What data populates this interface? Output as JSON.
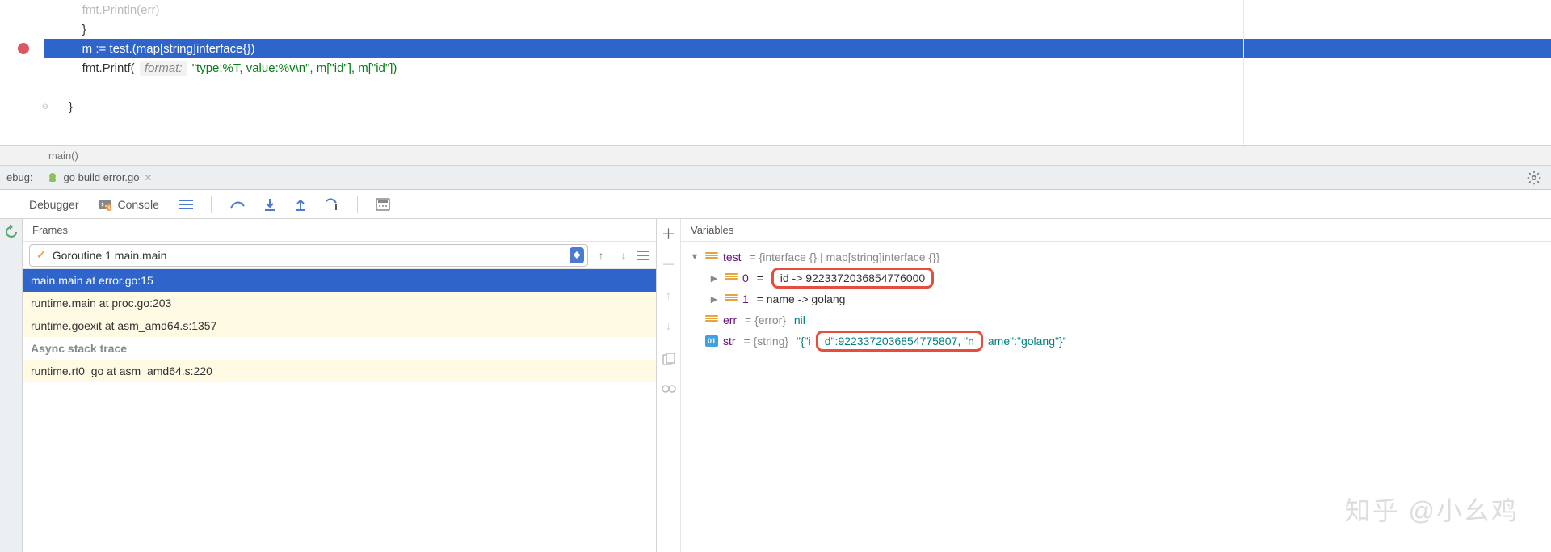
{
  "code": {
    "line1_partial": "    fmt.Println(err)",
    "line2": "    }",
    "line3": "    m := test.(map[string]interface{})",
    "line4_pre": "    fmt.Printf( ",
    "line4_hint": "format:",
    "line4_post": " \"type:%T, value:%v\\n\", m[\"id\"], m[\"id\"])",
    "line6": "}"
  },
  "breadcrumb": "main()",
  "debug": {
    "label": "ebug:",
    "tab": "go build error.go"
  },
  "panels": {
    "debugger": "Debugger",
    "console": "Console",
    "frames": "Frames",
    "variables": "Variables"
  },
  "goroutine": "Goroutine 1 main.main",
  "frames": [
    {
      "text": "main.main at error.go:15",
      "cls": "selected"
    },
    {
      "text": "runtime.main at proc.go:203",
      "cls": "yellow"
    },
    {
      "text": "runtime.goexit at asm_amd64.s:1357",
      "cls": "yellow"
    },
    {
      "text": "Async stack trace",
      "cls": "header-item"
    },
    {
      "text": "runtime.rt0_go at asm_amd64.s:220",
      "cls": "yellow"
    }
  ],
  "vars": {
    "test_name": "test",
    "test_type": " = {interface {} | map[string]interface {}}",
    "idx0": "0",
    "idx0_val": "id -> 9223372036854776000",
    "idx1": "1",
    "idx1_val": " = name -> golang",
    "err_name": "err",
    "err_type": " = {error} ",
    "err_val": "nil",
    "str_name": "str",
    "str_type": " = {string} ",
    "str_q1": "\"{\"i",
    "str_mid_d": "d",
    "str_mid": "\":9223372036854775807, \"",
    "str_mid_n": "n",
    "str_q2": "ame\":\"golang\"}\""
  },
  "watermark": "知乎 @小幺鸡"
}
